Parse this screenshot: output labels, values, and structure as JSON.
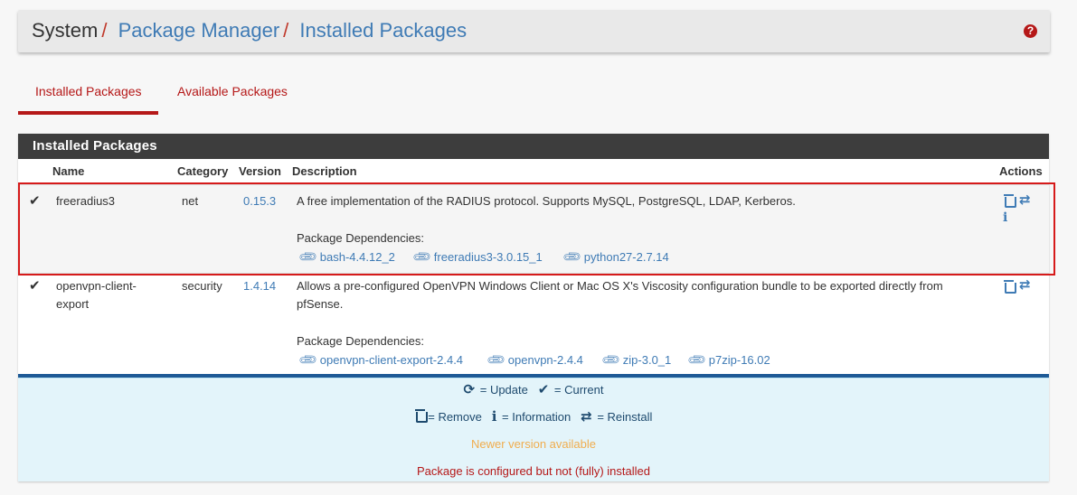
{
  "breadcrumb": {
    "root": "System",
    "sep": "/",
    "level2": "Package Manager",
    "level3": "Installed Packages"
  },
  "help_icon": "question-circle-icon",
  "tabs": [
    {
      "label": "Installed Packages",
      "active": true
    },
    {
      "label": "Available Packages",
      "active": false
    }
  ],
  "panel": {
    "title": "Installed Packages",
    "columns": {
      "name": "Name",
      "category": "Category",
      "version": "Version",
      "description": "Description",
      "actions": "Actions"
    }
  },
  "packages": [
    {
      "status_icon": "check-icon",
      "name": "freeradius3",
      "category": "net",
      "version": "0.15.3",
      "description": "A free implementation of the RADIUS protocol. Supports MySQL, PostgreSQL, LDAP, Kerberos.",
      "deps_label": "Package Dependencies:",
      "deps": [
        "bash-4.4.12_2",
        "freeradius3-3.0.15_1",
        "python27-2.7.14"
      ],
      "actions": [
        "trash-icon",
        "reinstall-icon",
        "info-icon"
      ],
      "highlighted": true
    },
    {
      "status_icon": "check-icon",
      "name_line1": "openvpn-client-",
      "name_line2": "export",
      "category": "security",
      "version": "1.4.14",
      "description_line1": "Allows a pre-configured OpenVPN Windows Client or Mac OS X's Viscosity configuration bundle to be exported directly from",
      "description_line2": "pfSense.",
      "deps_label": "Package Dependencies:",
      "deps": [
        "openvpn-client-export-2.4.4",
        "openvpn-2.4.4",
        "zip-3.0_1",
        "p7zip-16.02"
      ],
      "actions": [
        "trash-icon",
        "reinstall-icon"
      ]
    }
  ],
  "legend": {
    "update": "= Update",
    "current": "= Current",
    "remove": "= Remove",
    "information": "= Information",
    "reinstall": "= Reinstall",
    "newer": "Newer version available",
    "partial": "Package is configured but not (fully) installed"
  },
  "colors": {
    "accent_red": "#b51818",
    "link_blue": "#3f7bb5",
    "header_dark": "#3d3d3d",
    "newer_orange": "#f0ad4e",
    "legend_bg": "#e3f4fa"
  }
}
